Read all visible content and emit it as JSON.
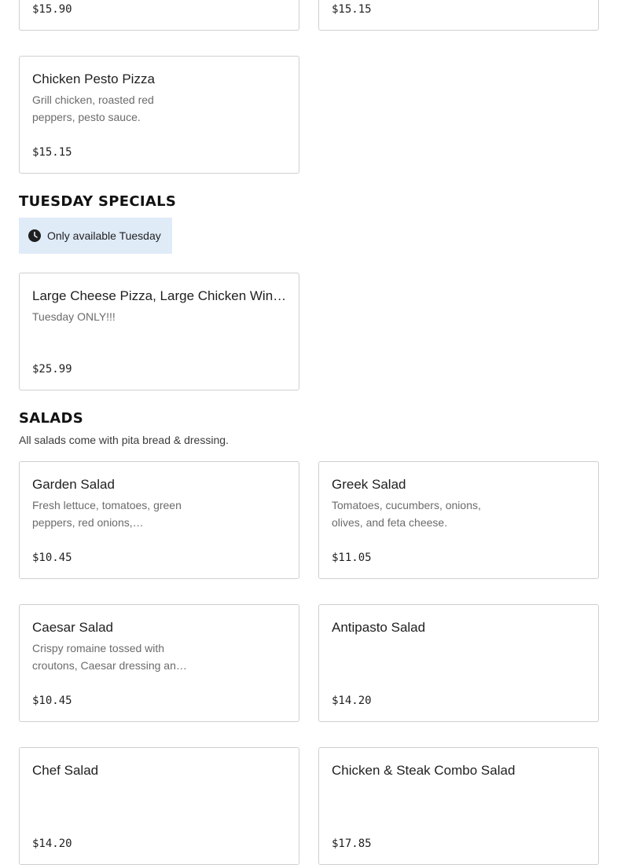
{
  "top_cards": [
    {
      "price": "$15.90"
    },
    {
      "price": "$15.15"
    }
  ],
  "pizza_cards": [
    {
      "name": "Chicken Pesto Pizza",
      "description": "Grill chicken, roasted red peppers, pesto sauce.",
      "price": "$15.15"
    }
  ],
  "tuesday": {
    "title": "TUESDAY SPECIALS",
    "banner_text": "Only available Tuesday",
    "items": [
      {
        "name": "Large Cheese Pizza, Large Chicken Wings, Large Fries",
        "description": "Tuesday ONLY!!!",
        "price": "$25.99"
      }
    ]
  },
  "salads": {
    "title": "SALADS",
    "subtitle": "All salads come with pita bread & dressing.",
    "items": [
      {
        "name": "Garden Salad",
        "description": "Fresh lettuce, tomatoes, green peppers, red onions, cucumbers, carrots.",
        "price": "$10.45"
      },
      {
        "name": "Greek Salad",
        "description": "Tomatoes, cucumbers, onions, olives, and feta cheese.",
        "price": "$11.05"
      },
      {
        "name": "Caesar Salad",
        "description": "Crispy romaine tossed with croutons, Caesar dressing and parmesan.",
        "price": "$10.45"
      },
      {
        "name": "Antipasto Salad",
        "description": "",
        "price": "$14.20"
      },
      {
        "name": "Chef Salad",
        "description": "",
        "price": "$14.20"
      },
      {
        "name": "Chicken & Steak Combo Salad",
        "description": "",
        "price": "$17.85"
      }
    ]
  },
  "icons": {
    "banner": "clock-icon"
  }
}
